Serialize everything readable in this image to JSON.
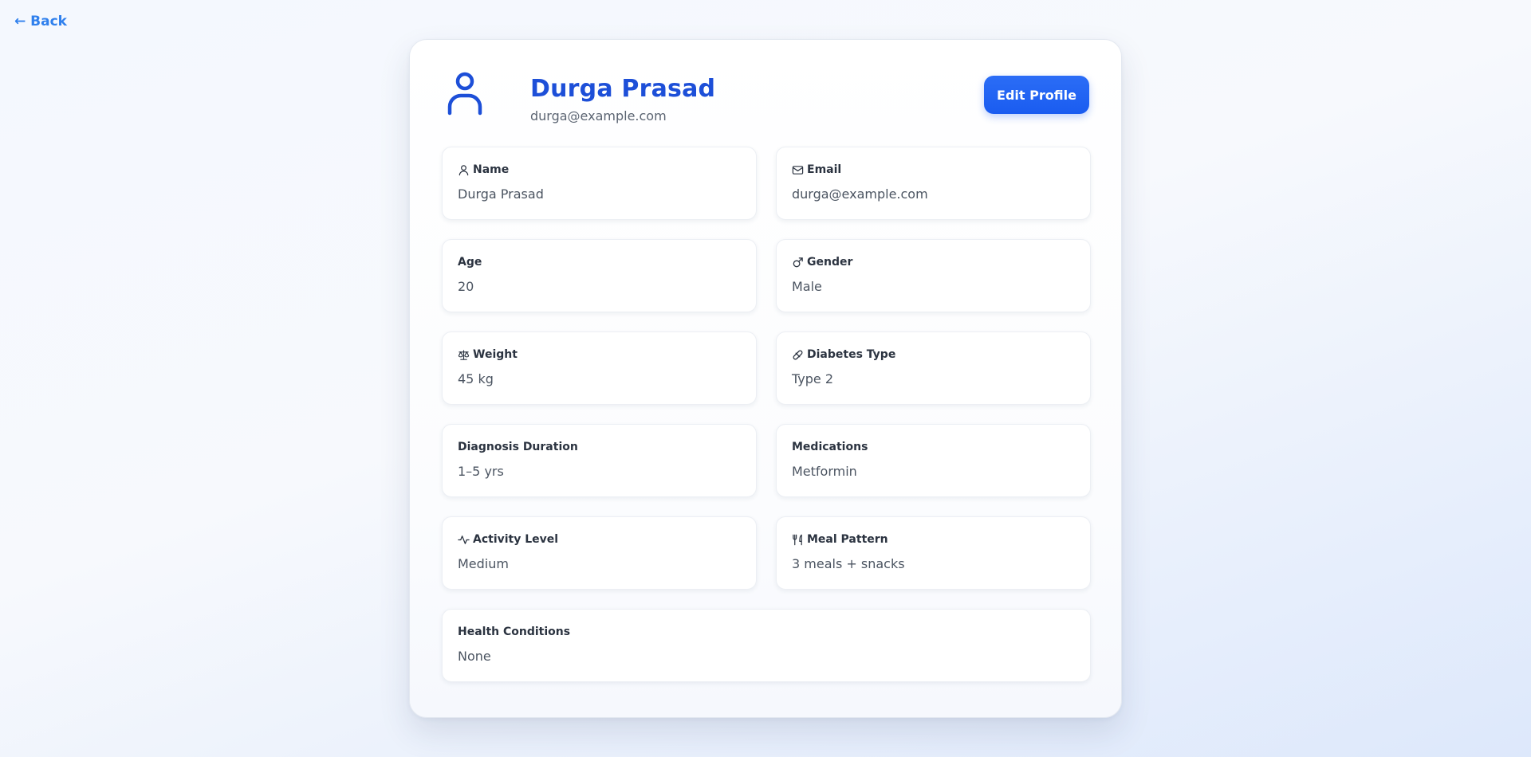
{
  "nav": {
    "back_label": "← Back"
  },
  "profile": {
    "name": "Durga Prasad",
    "email": "durga@example.com",
    "edit_button_label": "Edit Profile"
  },
  "fields": [
    {
      "label": "Name",
      "value": "Durga Prasad",
      "icon": "user-icon"
    },
    {
      "label": "Email",
      "value": "durga@example.com",
      "icon": "mail-icon"
    },
    {
      "label": "Age",
      "value": "20",
      "icon": ""
    },
    {
      "label": "Gender",
      "value": "Male",
      "icon": "male-icon"
    },
    {
      "label": "Weight",
      "value": "45 kg",
      "icon": "scale-icon"
    },
    {
      "label": "Diabetes Type",
      "value": "Type 2",
      "icon": "pill-icon"
    },
    {
      "label": "Diagnosis Duration",
      "value": "1–5 yrs",
      "icon": ""
    },
    {
      "label": "Medications",
      "value": "Metformin",
      "icon": ""
    },
    {
      "label": "Activity Level",
      "value": "Medium",
      "icon": "activity-icon"
    },
    {
      "label": "Meal Pattern",
      "value": "3 meals + snacks",
      "icon": "utensils-icon"
    },
    {
      "label": "Health Conditions",
      "value": "None",
      "icon": ""
    }
  ],
  "colors": {
    "accent": "#1d4fd8",
    "button": "#1a5cf0",
    "link": "#2f80ed"
  }
}
